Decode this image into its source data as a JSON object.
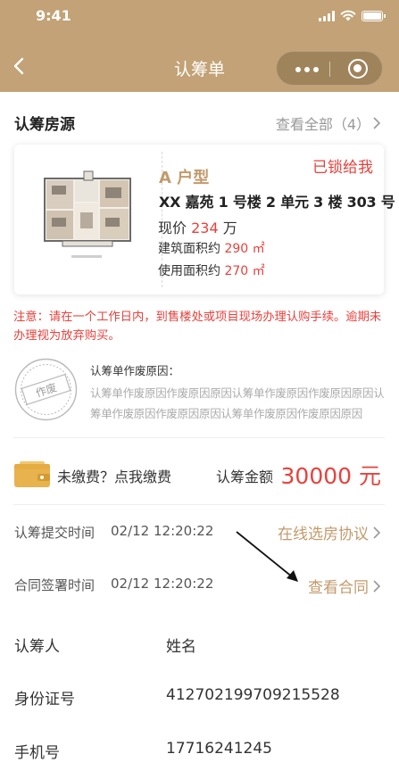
{
  "status_bar": {
    "time": "9:41"
  },
  "nav": {
    "title": "认筹单"
  },
  "house_section": {
    "title": "认筹房源",
    "view_all": "查看全部（4）"
  },
  "house": {
    "type": "A 户型",
    "status": "已锁给我",
    "building": "XX 嘉苑 1 号楼 2 单元 3 楼 303 号",
    "price_label": "现价",
    "price_value": "234",
    "price_unit": "万",
    "build_area_label": "建筑面积约",
    "build_area_value": "290 ㎡",
    "use_area_label": "使用面积约",
    "use_area_value": "270 ㎡"
  },
  "notice": "注意：请在一个工作日内，到售楼处或项目现场办理认购手续。逾期未办理视为放弃购买。",
  "void_info": {
    "stamp_text": "作废",
    "label": "认筹单作废原因：",
    "reason": "认筹单作废原因作废原因原因认筹单作废原因作废原因原因认筹单作废原因作废原因原因认筹单作废原因作废原因原因"
  },
  "payment": {
    "unpaid_text": "未缴费？点我缴费",
    "amount_label": "认筹金额",
    "amount": "30000 元"
  },
  "submit": {
    "label": "认筹提交时间",
    "time": "02/12 12:20:22",
    "link": "在线选房协议"
  },
  "contract": {
    "label": "合同签署时间",
    "time": "02/12 12:20:22",
    "link": "查看合同"
  },
  "person": {
    "name_label": "认筹人",
    "name_value": "姓名",
    "id_label": "身份证号",
    "id_value": "412702199709215528",
    "phone_label": "手机号",
    "phone_value": "17716241245"
  },
  "colors": {
    "header": "#c2a276",
    "gold": "#c29a6b",
    "red": "#e8413c"
  }
}
